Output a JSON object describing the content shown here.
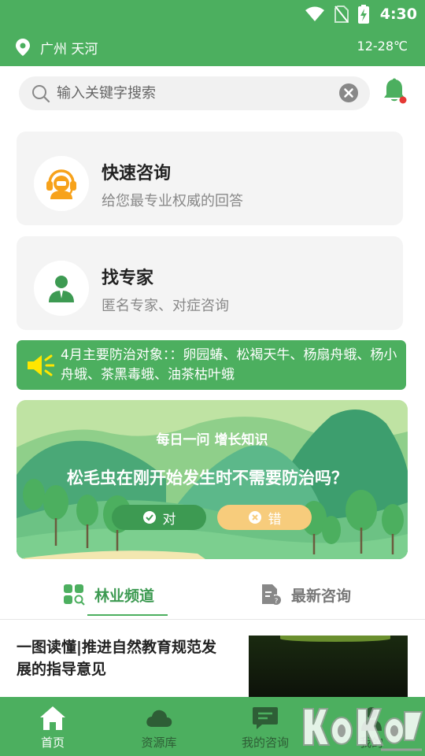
{
  "status_bar": {
    "time": "4:30"
  },
  "location_bar": {
    "location": "广州 天河",
    "weather": "12-28℃"
  },
  "search": {
    "placeholder": "输入关键字搜索"
  },
  "cards": [
    {
      "title": "快速咨询",
      "subtitle": "给您最专业权威的回答"
    },
    {
      "title": "找专家",
      "subtitle": "匿名专家、对症咨询"
    }
  ],
  "notice": {
    "text": "4月主要防治对象：：卵园蝽、松褐天牛、杨扇舟蛾、杨小舟蛾、茶黑毒蛾、油茶枯叶蛾"
  },
  "quiz": {
    "heading": "每日一问 增长知识",
    "question": "松毛虫在刚开始发生时不需要防治吗？",
    "true_label": "对",
    "false_label": "错"
  },
  "tabs": [
    {
      "label": "林业频道",
      "active": true
    },
    {
      "label": "最新咨询",
      "active": false
    }
  ],
  "article": {
    "title": "一图读懂|推进自然教育规范发展的指导意见"
  },
  "bottom_nav": [
    {
      "label": "首页",
      "icon": "home-icon",
      "active": true
    },
    {
      "label": "资源库",
      "icon": "cloud-icon",
      "active": false
    },
    {
      "label": "我的咨询",
      "icon": "chat-icon",
      "active": false
    },
    {
      "label": "我的",
      "icon": "person-icon",
      "active": false
    }
  ],
  "colors": {
    "primary": "#4caf5f",
    "dark_green": "#3d9a52",
    "card_bg": "#f4f4f4",
    "accent_orange": "#f7a21b",
    "badge_red": "#e53935"
  }
}
